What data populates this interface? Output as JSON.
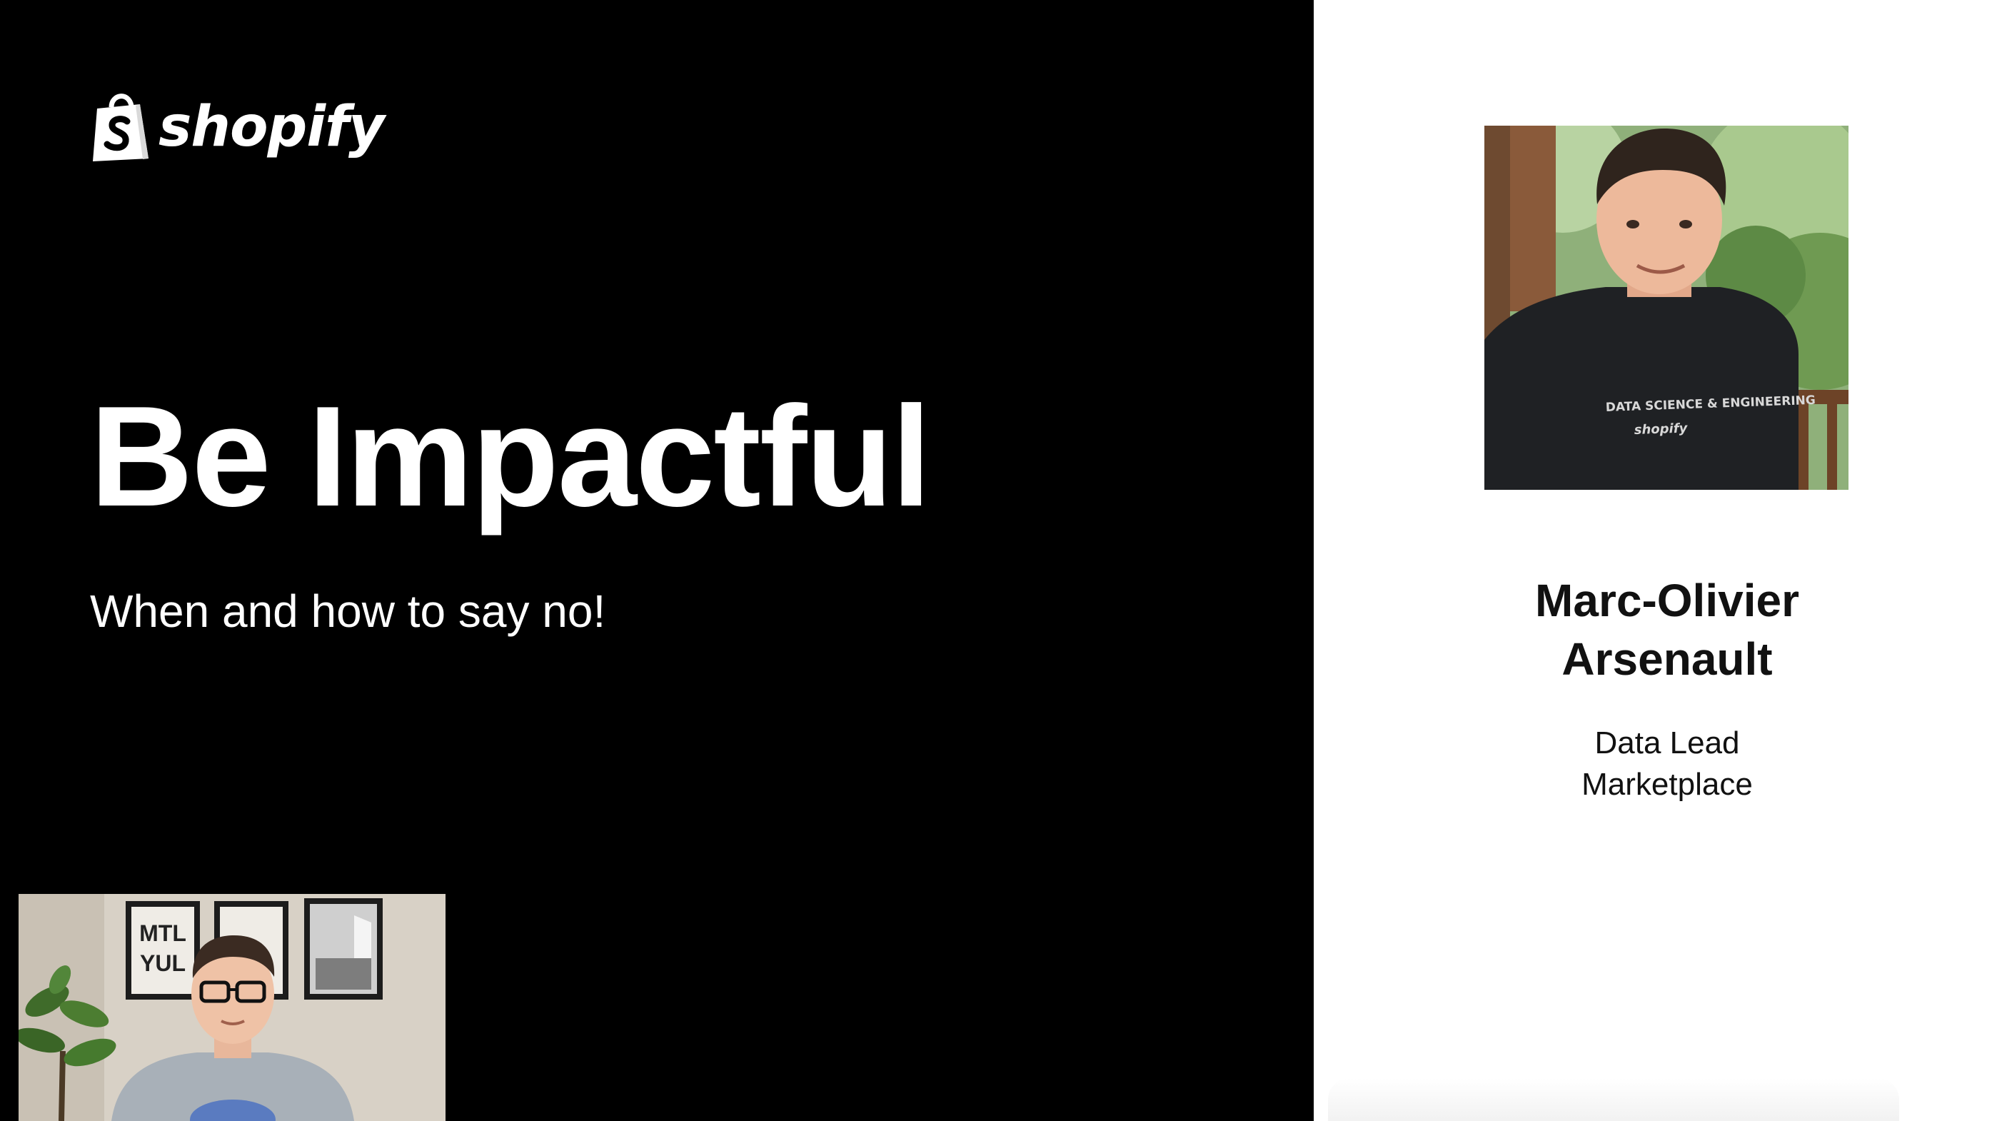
{
  "brand": {
    "logo_text": "shopify",
    "bag_icon": "shopify-bag-icon"
  },
  "slide": {
    "title": "Be Impactful",
    "subtitle": "When and how to say no!"
  },
  "speaker": {
    "name_line1": "Marc-Olivier",
    "name_line2": "Arsenault",
    "role_line1": "Data Lead",
    "role_line2": "Marketplace",
    "shirt_text": "DATA SCIENCE & ENGINEERING",
    "shirt_logo": "shopify"
  },
  "webcam": {
    "frame1_line1": "MTL",
    "frame1_line2": "YUL"
  },
  "colors": {
    "left_bg": "#000000",
    "right_bg": "#ffffff",
    "text_light": "#ffffff",
    "text_dark": "#111111"
  }
}
